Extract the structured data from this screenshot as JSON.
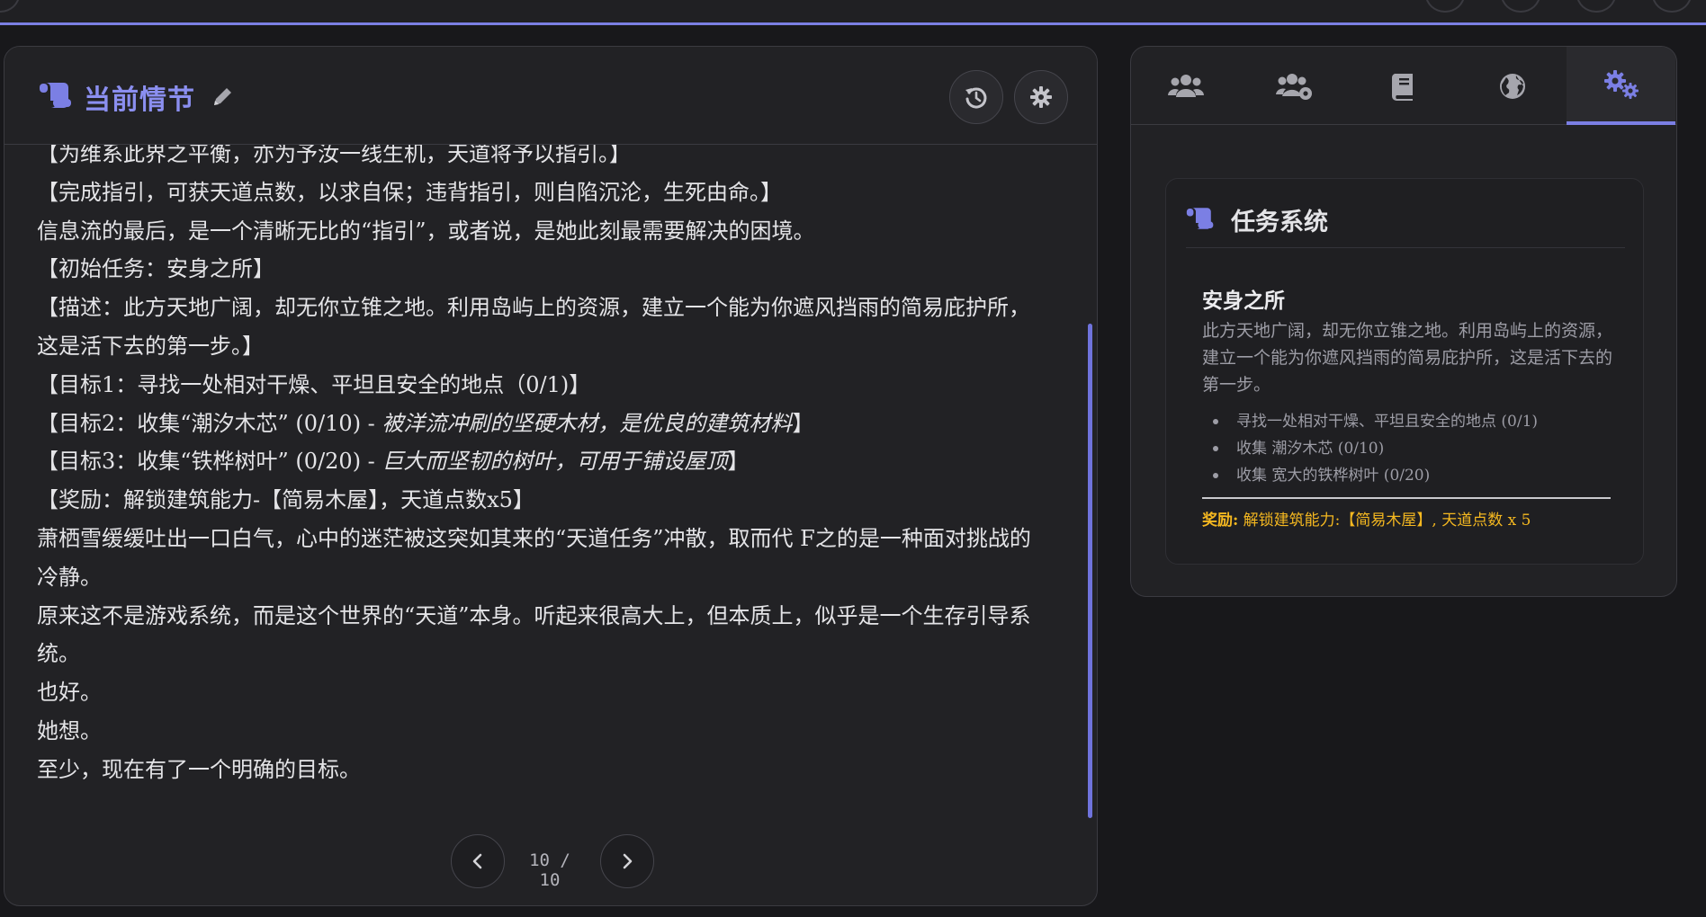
{
  "colors": {
    "accent": "#7b7fe4",
    "title": "#8b8ff0",
    "reward": "#f5b820",
    "panel": "#222225",
    "background": "#18181b"
  },
  "story": {
    "title": "当前情节",
    "title_icon": "scroll-icon",
    "edit_icon": "pencil-icon",
    "history_icon": "history-icon",
    "settings_icon": "gear-icon",
    "lines": [
      "【为维系此界之平衡，亦为予汝一线生机，天道将予以指引。】",
      "【完成指引，可获天道点数，以求自保；违背指引，则自陷沉沦，生死由命。】",
      "信息流的最后，是一个清晰无比的“指引”，或者说，是她此刻最需要解决的困境。",
      "【初始任务：安身之所】",
      "【描述：此方天地广阔，却无你立锥之地。利用岛屿上的资源，建立一个能为你遮风挡雨的简易庇护所，这是活下去的第一步。】",
      "【目标1：寻找一处相对干燥、平坦且安全的地点（0/1)】"
    ],
    "goal2_prefix": "【目标2：收集“潮汐木芯” (0/10) - ",
    "goal2_desc": "被洋流冲刷的坚硬木材，是优良的建筑材料",
    "goal2_suffix": "】",
    "goal3_prefix": "【目标3：收集“铁桦树叶” (0/20) - ",
    "goal3_desc": "巨大而坚韧的树叶，可用于铺设屋顶",
    "goal3_suffix": "】",
    "lines_after": [
      "【奖励：解锁建筑能力-【简易木屋】，天道点数x5】",
      "萧栖雪缓缓吐出一口白气，心中的迷茫被这突如其来的“天道任务”冲散，取而代 F之的是一种面对挑战的冷静。",
      "原来这不是游戏系统，而是这个世界的“天道”本身。听起来很高大上，但本质上，似乎是一个生存引导系统。",
      "也好。",
      "她想。",
      "至少，现在有了一个明确的目标。"
    ]
  },
  "pager": {
    "text": "10 / 10",
    "current": 10,
    "total": 10,
    "prev_icon": "chevron-left-icon",
    "next_icon": "chevron-right-icon"
  },
  "side": {
    "tabs": [
      {
        "icon": "users-icon",
        "active": false
      },
      {
        "icon": "users-cog-icon",
        "active": false
      },
      {
        "icon": "book-icon",
        "active": false
      },
      {
        "icon": "globe-icon",
        "active": false
      },
      {
        "icon": "gears-icon",
        "active": true
      }
    ],
    "quest": {
      "header": "任务系统",
      "header_icon": "scroll-icon",
      "name": "安身之所",
      "description": "此方天地广阔，却无你立锥之地。利用岛屿上的资源，建立一个能为你遮风挡雨的简易庇护所，这是活下去的第一步。",
      "objectives": [
        "寻找一处相对干燥、平坦且安全的地点 (0/1)",
        "收集 潮汐木芯 (0/10)",
        "收集 宽大的铁桦树叶 (0/20)"
      ],
      "reward_label": "奖励:",
      "reward_text": " 解锁建筑能力:【简易木屋】, 天道点数 x 5"
    }
  }
}
